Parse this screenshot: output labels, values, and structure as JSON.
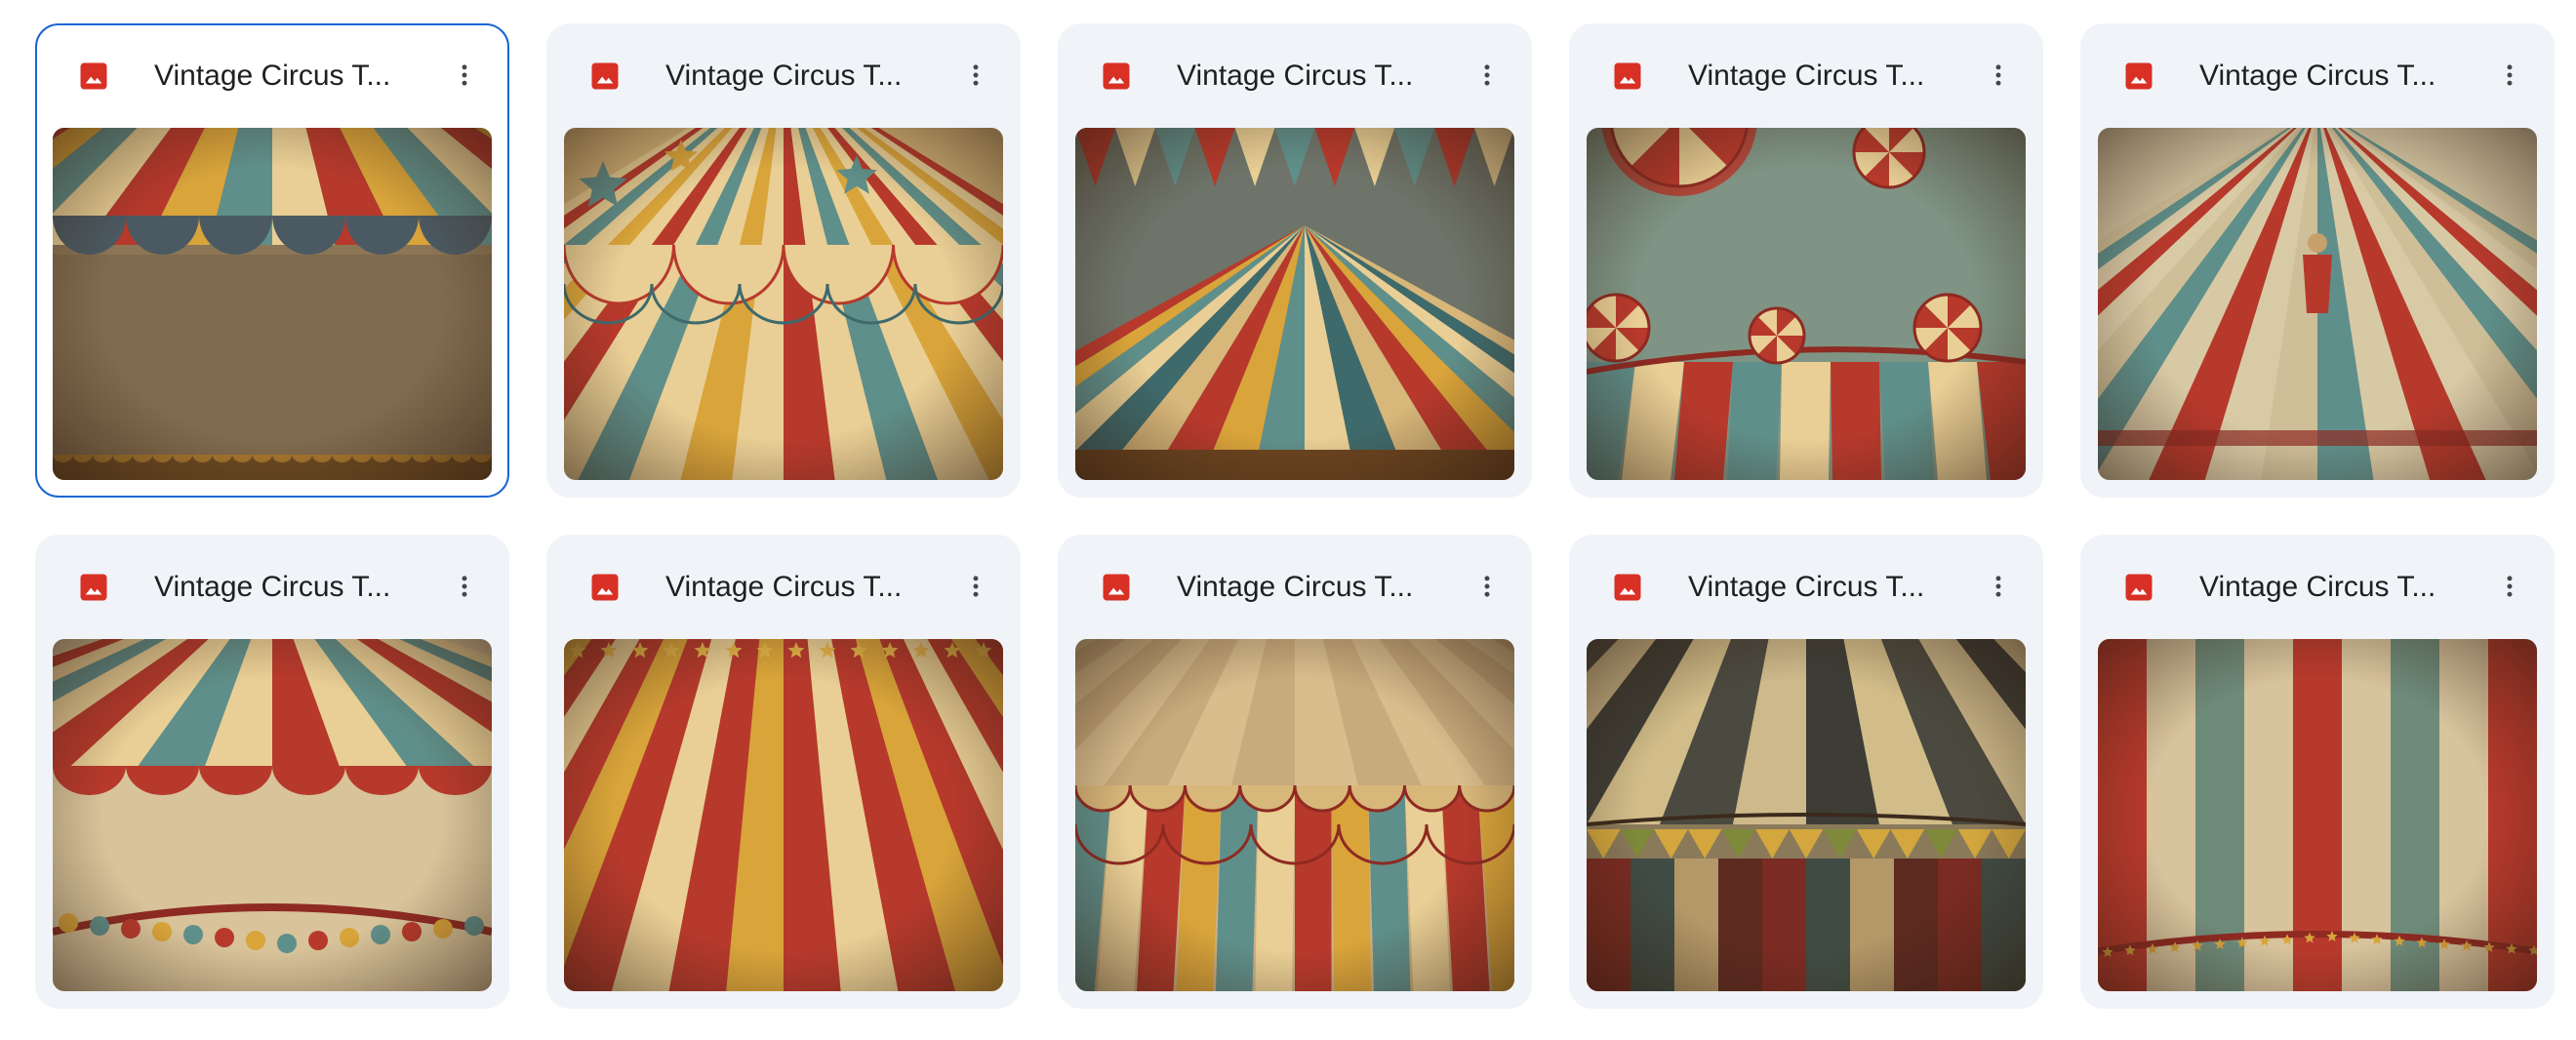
{
  "files": [
    {
      "title": "Vintage Circus T...",
      "type_icon": "image-icon",
      "selected": true,
      "art": "canopy-top-plain"
    },
    {
      "title": "Vintage Circus T...",
      "type_icon": "image-icon",
      "selected": false,
      "art": "starburst-swags"
    },
    {
      "title": "Vintage Circus T...",
      "type_icon": "image-icon",
      "selected": false,
      "art": "tent-peak"
    },
    {
      "title": "Vintage Circus T...",
      "type_icon": "image-icon",
      "selected": false,
      "art": "teal-sky-wheels"
    },
    {
      "title": "Vintage Circus T...",
      "type_icon": "image-icon",
      "selected": false,
      "art": "tent-interior-rays"
    },
    {
      "title": "Vintage Circus T...",
      "type_icon": "image-icon",
      "selected": false,
      "art": "canopy-bunting"
    },
    {
      "title": "Vintage Circus T...",
      "type_icon": "image-icon",
      "selected": false,
      "art": "star-stripes"
    },
    {
      "title": "Vintage Circus T...",
      "type_icon": "image-icon",
      "selected": false,
      "art": "garland-stripes"
    },
    {
      "title": "Vintage Circus T...",
      "type_icon": "image-icon",
      "selected": false,
      "art": "dark-tent-pennants"
    },
    {
      "title": "Vintage Circus T...",
      "type_icon": "image-icon",
      "selected": false,
      "art": "vertical-stripes"
    }
  ],
  "colors": {
    "card_bg": "#f0f4f9",
    "selected_border": "#1a66d2",
    "image_icon": "#d93025",
    "title_text": "#1f1f1f",
    "menu_icon": "#444746"
  }
}
